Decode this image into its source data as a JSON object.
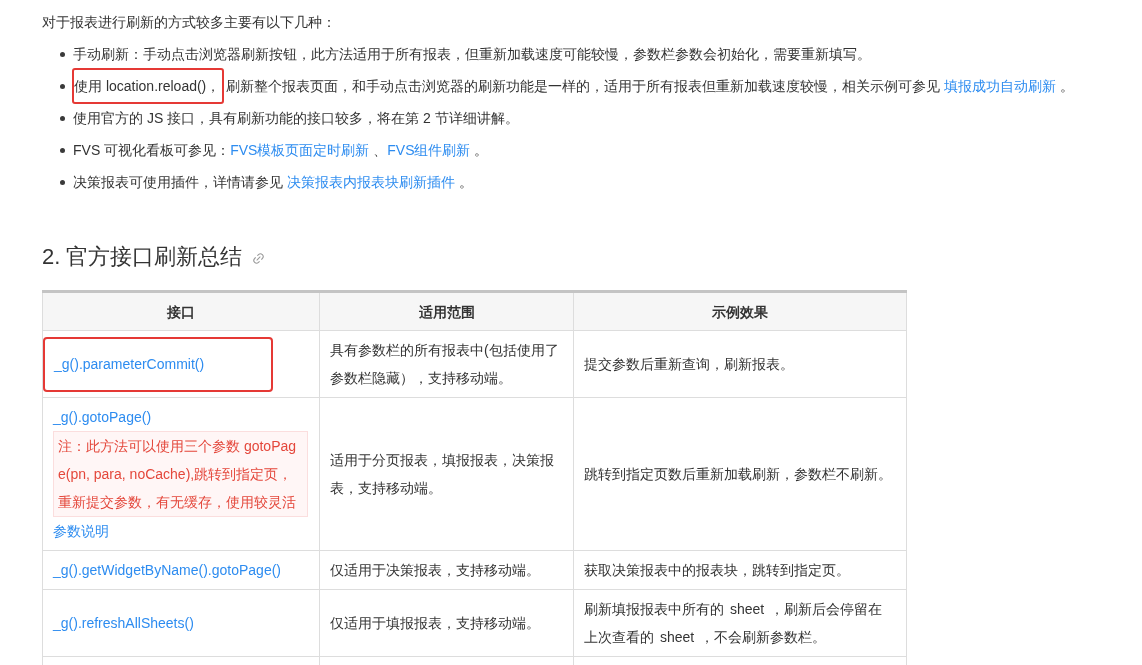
{
  "intro": "对于报表进行刷新的方式较多主要有以下几种：",
  "bullets": [
    {
      "parts": [
        {
          "kind": "text",
          "text": "手动刷新：手动点击浏览器刷新按钮，此方法适用于所有报表，但重新加载速度可能较慢，参数栏参数会初始化，需要重新填写。"
        }
      ]
    },
    {
      "parts": [
        {
          "kind": "highlight",
          "text": "使用 location.reload()，"
        },
        {
          "kind": "text",
          "text": "刷新整个报表页面，和手动点击浏览器的刷新功能是一样的，适用于所有报表但重新加载速度较慢，相关示例可参见 "
        },
        {
          "kind": "link",
          "text": "填报成功自动刷新"
        },
        {
          "kind": "text",
          "text": " 。"
        }
      ]
    },
    {
      "parts": [
        {
          "kind": "text",
          "text": "使用官方的 JS 接口，具有刷新功能的接口较多，将在第 2 节详细讲解。"
        }
      ]
    },
    {
      "parts": [
        {
          "kind": "text",
          "text": "FVS 可视化看板可参见："
        },
        {
          "kind": "link",
          "text": "FVS模板页面定时刷新"
        },
        {
          "kind": "text",
          "text": " 、"
        },
        {
          "kind": "link",
          "text": "FVS组件刷新"
        },
        {
          "kind": "text",
          "text": " 。"
        }
      ]
    },
    {
      "parts": [
        {
          "kind": "text",
          "text": "决策报表可使用插件，详情请参见 "
        },
        {
          "kind": "link",
          "text": "决策报表内报表块刷新插件"
        },
        {
          "kind": "text",
          "text": " 。"
        }
      ]
    }
  ],
  "section_heading": "2. 官方接口刷新总结",
  "table": {
    "columns": [
      "接口",
      "适用范围",
      "示例效果"
    ],
    "rows": [
      {
        "highlighted": true,
        "interface": [
          {
            "kind": "link",
            "text": "_g().parameterCommit()"
          }
        ],
        "scope": "具有参数栏的所有报表中(包括使用了参数栏隐藏），支持移动端。",
        "effect": "提交参数后重新查询，刷新报表。"
      },
      {
        "highlighted": false,
        "interface": [
          {
            "kind": "link",
            "text": "_g().gotoPage()"
          },
          {
            "kind": "note",
            "text": "注：此方法可以使用三个参数 gotoPage(pn, para, noCache),跳转到指定页，重新提交参数，有无缓存，使用较灵活"
          },
          {
            "kind": "link",
            "text": "参数说明"
          }
        ],
        "scope": "适用于分页报表，填报报表，决策报表，支持移动端。",
        "effect": "跳转到指定页数后重新加载刷新，参数栏不刷新。"
      },
      {
        "highlighted": false,
        "interface": [
          {
            "kind": "link",
            "text": "_g().getWidgetByName().gotoPage()"
          }
        ],
        "scope": "仅适用于决策报表，支持移动端。",
        "effect": "获取决策报表中的报表块，跳转到指定页。"
      },
      {
        "highlighted": false,
        "interface": [
          {
            "kind": "link",
            "text": "_g().refreshAllSheets()"
          }
        ],
        "scope": "仅适用于填报报表，支持移动端。",
        "effect": "刷新填报报表中所有的 sheet ，刷新后会停留在上次查看的 sheet ，不会刷新参数栏。"
      }
    ]
  }
}
